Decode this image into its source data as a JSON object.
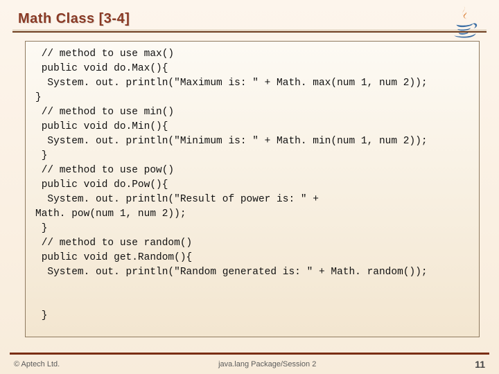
{
  "title": "Math Class [3-4]",
  "code": " // method to use max()\n public void do.Max(){\n  System. out. println(\"Maximum is: \" + Math. max(num 1, num 2));\n}\n // method to use min()\n public void do.Min(){\n  System. out. println(\"Minimum is: \" + Math. min(num 1, num 2));\n }\n // method to use pow()\n public void do.Pow(){\n  System. out. println(\"Result of power is: \" +\nMath. pow(num 1, num 2));\n }\n // method to use random()\n public void get.Random(){\n  System. out. println(\"Random generated is: \" + Math. random());\n\n\n }",
  "footer": {
    "left": "© Aptech Ltd.",
    "center": "java.lang Package/Session 2",
    "right": "11"
  }
}
